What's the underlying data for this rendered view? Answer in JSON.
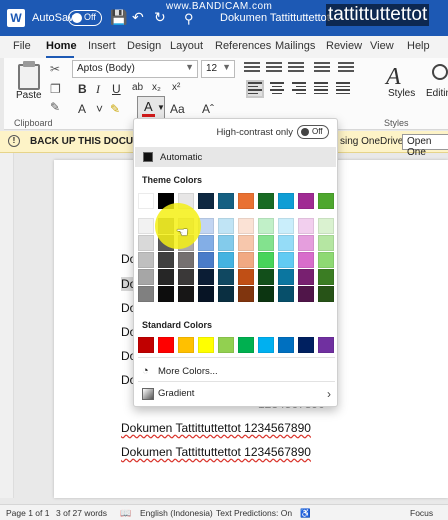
{
  "titlebar": {
    "logo": "W",
    "autosave_label": "AutoSave",
    "autosave_state": "Off",
    "doc_title": "Dokumen Tattittuttettot",
    "watermark": "www.BANDICAM.com",
    "overlay_title": "tattittuttettot"
  },
  "menu": {
    "tabs": [
      "File",
      "Home",
      "Insert",
      "Design",
      "Layout",
      "References",
      "Mailings",
      "Review",
      "View",
      "Help"
    ],
    "active": "Home"
  },
  "ribbon": {
    "paste_label": "Paste",
    "font_name": "Aptos (Body)",
    "font_size": "12",
    "styles_label": "Styles",
    "editing_label": "Editing",
    "groups": {
      "clipboard": "Clipboard",
      "styles": "Styles"
    },
    "font_color_accent": "#d11a1a"
  },
  "infobar": {
    "text": "BACK UP THIS DOCUMEN",
    "rest": "sing OneDrive.",
    "button": "Open One"
  },
  "document": {
    "lines": [
      "Dokumen Tattittuttettot 1234567890",
      "Dokumen Tattittuttettot 1234567890",
      "Dokumen Tattittuttettot 1234567890"
    ],
    "fragments": [
      "Do",
      "Do",
      "Do",
      "Do",
      "Do",
      "Do"
    ],
    "partial_suffix": "1234567890"
  },
  "color_menu": {
    "high_contrast_label": "High-contrast only",
    "high_contrast_state": "Off",
    "automatic_label": "Automatic",
    "theme_colors_title": "Theme Colors",
    "standard_colors_title": "Standard Colors",
    "more_colors_label": "More Colors...",
    "gradient_label": "Gradient",
    "theme_top": [
      "#ffffff",
      "#000000",
      "#e7e6e6",
      "#0e2841",
      "#156082",
      "#e97132",
      "#196b24",
      "#0f9ed5",
      "#a02b93",
      "#4ea72e"
    ],
    "theme_shades": [
      [
        "#f2f2f2",
        "#7f7f7f",
        "#d0cece",
        "#c2d5f2",
        "#c0e4f5",
        "#fbe2d5",
        "#c1f0c8",
        "#caeefb",
        "#f2cfee",
        "#daf2d0"
      ],
      [
        "#d9d9d9",
        "#595959",
        "#aeaaaa",
        "#83aee6",
        "#83cbeb",
        "#f7c7ac",
        "#83e28e",
        "#95dcf7",
        "#e59edd",
        "#b5e6a2"
      ],
      [
        "#bfbfbf",
        "#404040",
        "#757070",
        "#4a7cc9",
        "#44b3e1",
        "#f1a983",
        "#47d45a",
        "#61cbf3",
        "#d86dcb",
        "#8ed973"
      ],
      [
        "#a6a6a6",
        "#262626",
        "#3a3838",
        "#0b1d35",
        "#104861",
        "#c04f15",
        "#124f1a",
        "#0b76a0",
        "#782070",
        "#3b7d23"
      ],
      [
        "#808080",
        "#0d0d0d",
        "#171616",
        "#071425",
        "#0a2f41",
        "#80350e",
        "#0c3511",
        "#074f6a",
        "#501549",
        "#275317"
      ]
    ],
    "standard": [
      "#c00000",
      "#ff0000",
      "#ffc000",
      "#ffff00",
      "#92d050",
      "#00b050",
      "#00b0f0",
      "#0070c0",
      "#002060",
      "#7030a0"
    ]
  },
  "statusbar": {
    "page": "Page 1 of 1",
    "words": "3 of 27 words",
    "language": "English (Indonesia)",
    "predictions": "Text Predictions: On",
    "focus": "Focus"
  }
}
